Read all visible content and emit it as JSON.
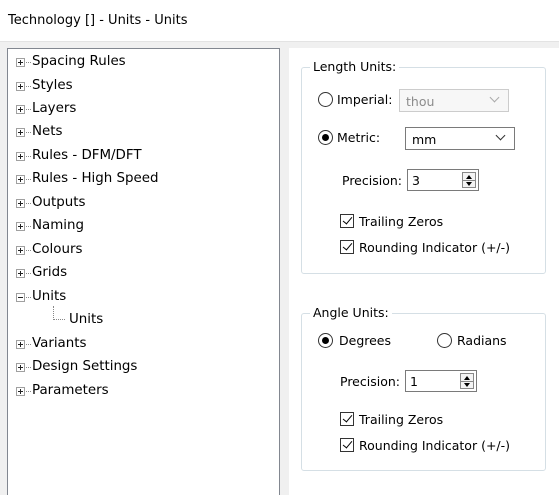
{
  "window": {
    "title": "Technology [] - Units - Units"
  },
  "tree": {
    "items": [
      {
        "label": "Spacing Rules",
        "state": "collapsed"
      },
      {
        "label": "Styles",
        "state": "collapsed"
      },
      {
        "label": "Layers",
        "state": "collapsed"
      },
      {
        "label": "Nets",
        "state": "collapsed"
      },
      {
        "label": "Rules - DFM/DFT",
        "state": "collapsed"
      },
      {
        "label": "Rules - High Speed",
        "state": "collapsed"
      },
      {
        "label": "Outputs",
        "state": "collapsed"
      },
      {
        "label": "Naming",
        "state": "collapsed"
      },
      {
        "label": "Colours",
        "state": "collapsed"
      },
      {
        "label": "Grids",
        "state": "collapsed"
      },
      {
        "label": "Units",
        "state": "expanded"
      },
      {
        "label": "Units",
        "state": "selected-child"
      },
      {
        "label": "Variants",
        "state": "collapsed"
      },
      {
        "label": "Design Settings",
        "state": "collapsed"
      },
      {
        "label": "Parameters",
        "state": "collapsed"
      }
    ]
  },
  "length_units": {
    "title": "Length Units:",
    "imperial_label": "Imperial:",
    "imperial_value": "thou",
    "metric_label": "Metric:",
    "metric_value": "mm",
    "selected": "metric",
    "precision_label": "Precision:",
    "precision_value": "3",
    "trailing_zeros_label": "Trailing Zeros",
    "trailing_zeros_checked": true,
    "rounding_label": "Rounding Indicator (+/-)",
    "rounding_checked": true
  },
  "angle_units": {
    "title": "Angle Units:",
    "degrees_label": "Degrees",
    "radians_label": "Radians",
    "selected": "degrees",
    "precision_label": "Precision:",
    "precision_value": "1",
    "trailing_zeros_label": "Trailing Zeros",
    "trailing_zeros_checked": true,
    "rounding_label": "Rounding Indicator (+/-)",
    "rounding_checked": true
  }
}
